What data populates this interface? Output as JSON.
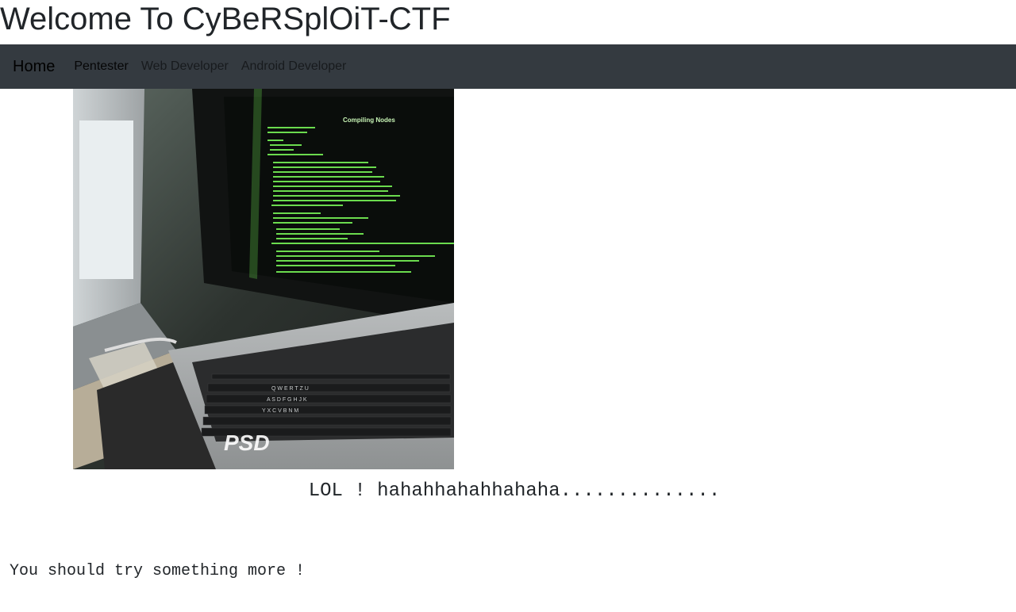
{
  "page": {
    "title": "Welcome To CyBeRSplOiT-CTF"
  },
  "navbar": {
    "brand": "Home",
    "links": [
      {
        "label": "Pentester",
        "active": true
      },
      {
        "label": "Web Developer",
        "active": false
      },
      {
        "label": "Android Developer",
        "active": false
      }
    ]
  },
  "hero_image": {
    "watermark": "PSD",
    "screen_heading": "Compiling Nodes"
  },
  "content": {
    "lol_text": "LOL ! hahahhahahhahaha..............",
    "hint_text": "You should try something more !"
  },
  "colors": {
    "navbar_bg": "#343a40",
    "terminal_green": "#7cff5a",
    "page_bg": "#ffffff"
  }
}
